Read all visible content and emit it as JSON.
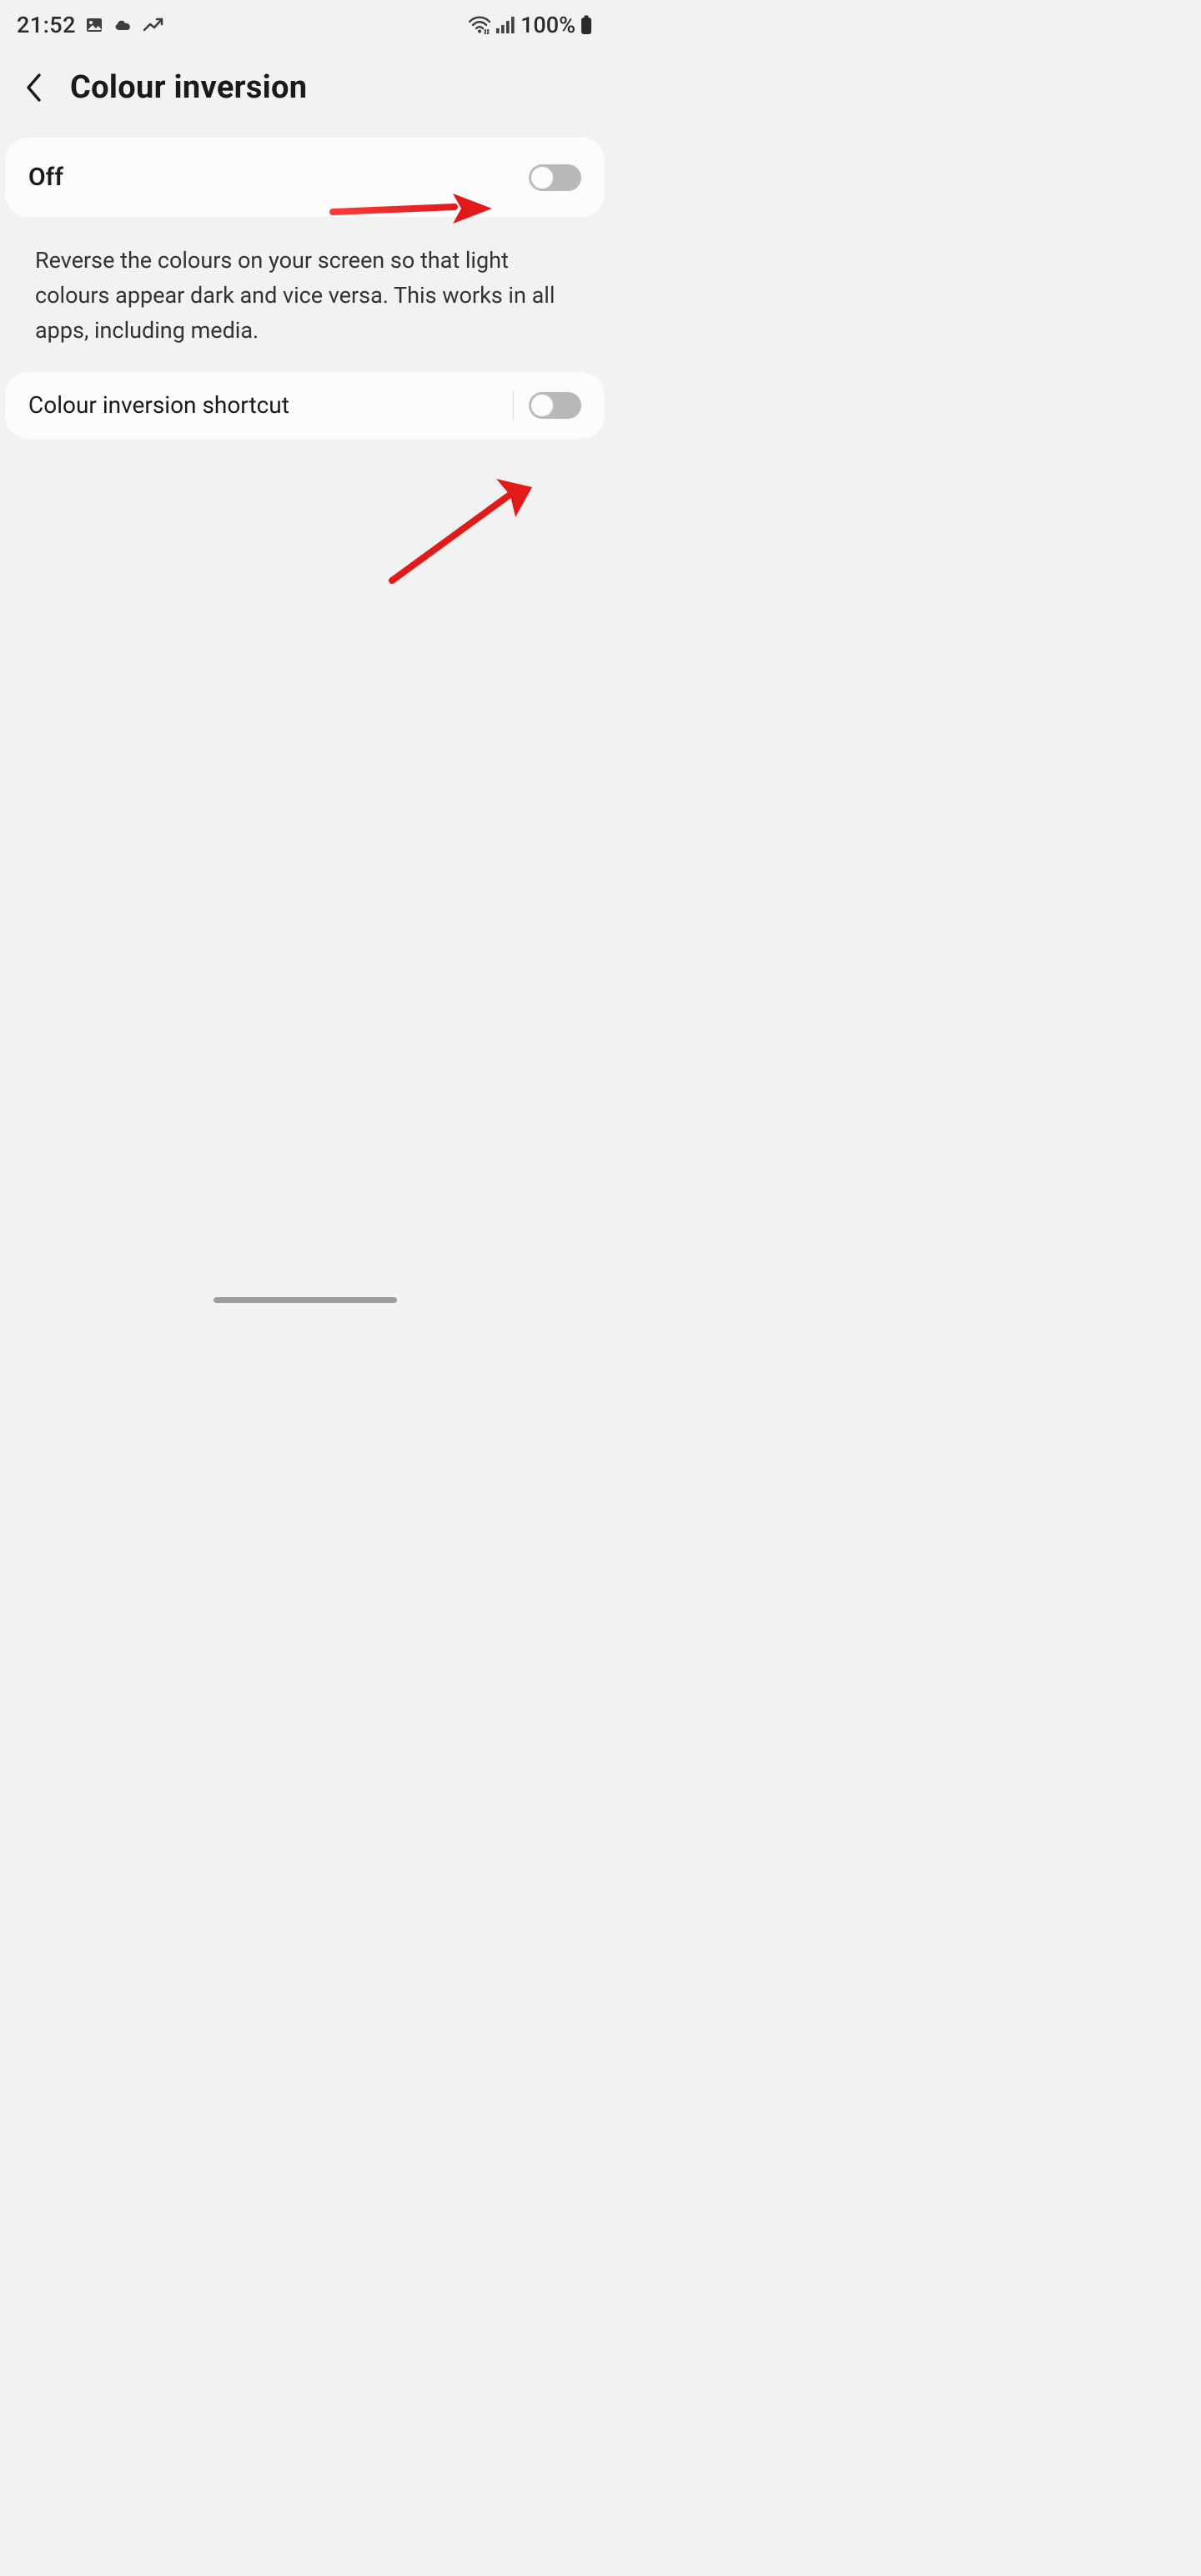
{
  "status": {
    "time": "21:52",
    "battery": "100%"
  },
  "header": {
    "title": "Colour inversion"
  },
  "main_toggle": {
    "label": "Off",
    "state": false
  },
  "description": "Reverse the colours on your screen so that light colours appear dark and vice versa. This works in all apps, including media.",
  "shortcut_row": {
    "label": "Colour inversion shortcut",
    "state": false
  },
  "icons": {
    "back": "chevron-left",
    "status_left": [
      "image-icon",
      "cloud-icon",
      "trend-icon"
    ],
    "status_right": [
      "wifi-icon",
      "signal-icon",
      "battery-icon"
    ]
  },
  "annotations": {
    "arrow1": {
      "targets": "main_toggle"
    },
    "arrow2": {
      "targets": "shortcut_toggle"
    }
  }
}
